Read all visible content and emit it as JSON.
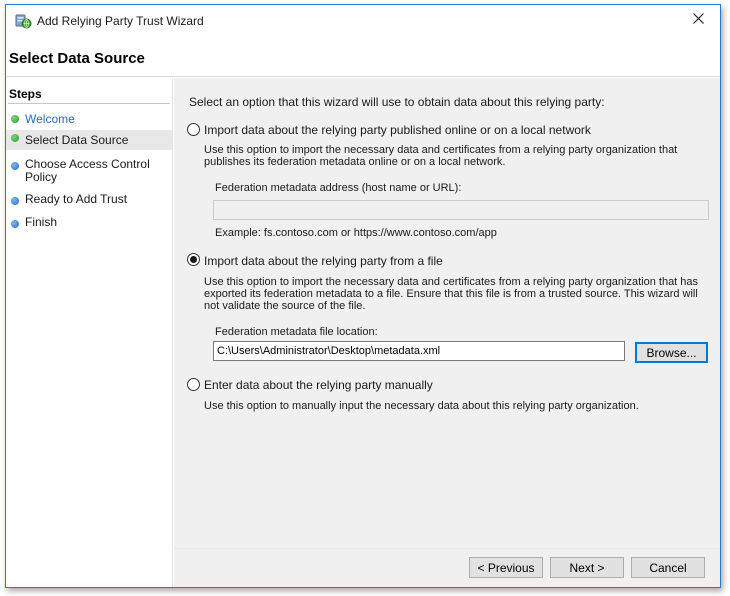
{
  "window": {
    "title": "Add Relying Party Trust Wizard",
    "page_title": "Select Data Source",
    "icons": {
      "app": "server-trust-icon",
      "close": "close-icon"
    }
  },
  "sidebar": {
    "heading": "Steps",
    "items": [
      {
        "label": "Welcome",
        "status": "done",
        "dot_color": "#2f9b2f"
      },
      {
        "label": "Select Data Source",
        "status": "current",
        "dot_color": "#2f9b2f"
      },
      {
        "label": "Choose Access Control Policy",
        "status": "pending",
        "dot_color": "#2b6fc7"
      },
      {
        "label": "Ready to Add Trust",
        "status": "pending",
        "dot_color": "#2b6fc7"
      },
      {
        "label": "Finish",
        "status": "pending",
        "dot_color": "#2b6fc7"
      }
    ]
  },
  "content": {
    "intro": "Select an option that this wizard will use to obtain data about this relying party:",
    "options": [
      {
        "label": "Import data about the relying party published online or on a local network",
        "checked": false,
        "description": "Use this option to import the necessary data and certificates from a relying party organization that publishes its federation metadata online or on a local network.",
        "field_label": "Federation metadata address (host name or URL):",
        "field_value": "",
        "example": "Example: fs.contoso.com or https://www.contoso.com/app"
      },
      {
        "label": "Import data about the relying party from a file",
        "checked": true,
        "description": "Use this option to import the necessary data and certificates from a relying party organization that has exported its federation metadata to a file. Ensure that this file is from a trusted source.  This wizard will not validate the source of the file.",
        "field_label": "Federation metadata file location:",
        "field_value": "C:\\Users\\Administrator\\Desktop\\metadata.xml",
        "browse_label": "Browse..."
      },
      {
        "label": "Enter data about the relying party manually",
        "checked": false,
        "description": "Use this option to manually input the necessary data about this relying party organization."
      }
    ]
  },
  "footer": {
    "previous_label": "< Previous",
    "next_label": "Next >",
    "cancel_label": "Cancel"
  }
}
